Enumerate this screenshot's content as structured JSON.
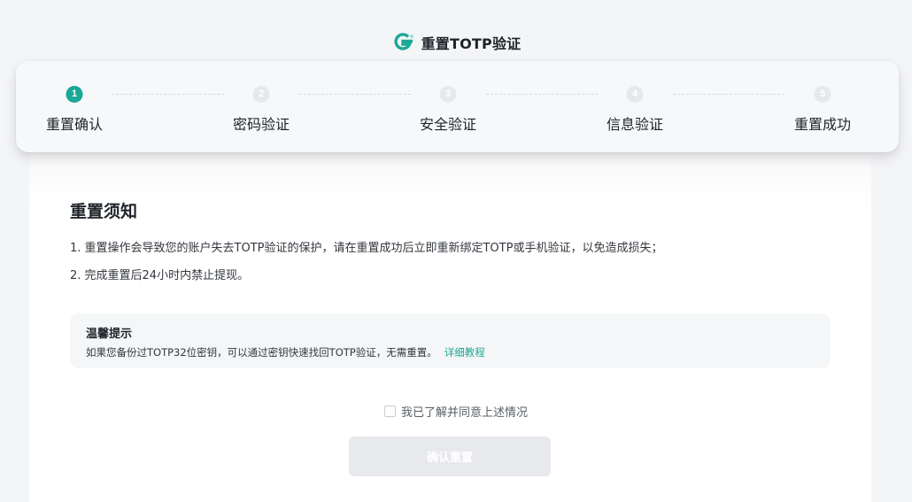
{
  "header": {
    "logo_icon": "brand-logo-icon",
    "title": "重置TOTP验证"
  },
  "stepper": {
    "steps": [
      {
        "number": "1",
        "label": "重置确认",
        "state": "active"
      },
      {
        "number": "2",
        "label": "密码验证",
        "state": "inactive"
      },
      {
        "number": "3",
        "label": "安全验证",
        "state": "inactive"
      },
      {
        "number": "4",
        "label": "信息验证",
        "state": "inactive"
      },
      {
        "number": "5",
        "label": "重置成功",
        "state": "inactive"
      }
    ]
  },
  "notice": {
    "title": "重置须知",
    "items": [
      "1. 重置操作会导致您的账户失去TOTP验证的保护，请在重置成功后立即重新绑定TOTP或手机验证，以免造成损失；",
      "2. 完成重置后24小时内禁止提现。"
    ]
  },
  "tip": {
    "title": "温馨提示",
    "text": "如果您备份过TOTP32位密钥，可以通过密钥快速找回TOTP验证，无需重置。",
    "link": "详细教程"
  },
  "agreement": {
    "checked": false,
    "label": "我已了解并同意上述情况"
  },
  "confirm_button": {
    "label": "确认重置",
    "enabled": false
  },
  "colors": {
    "accent": "#1ba896",
    "disabled_button": "#e8e9ec",
    "stepper_bg": "#f7f8f9"
  }
}
